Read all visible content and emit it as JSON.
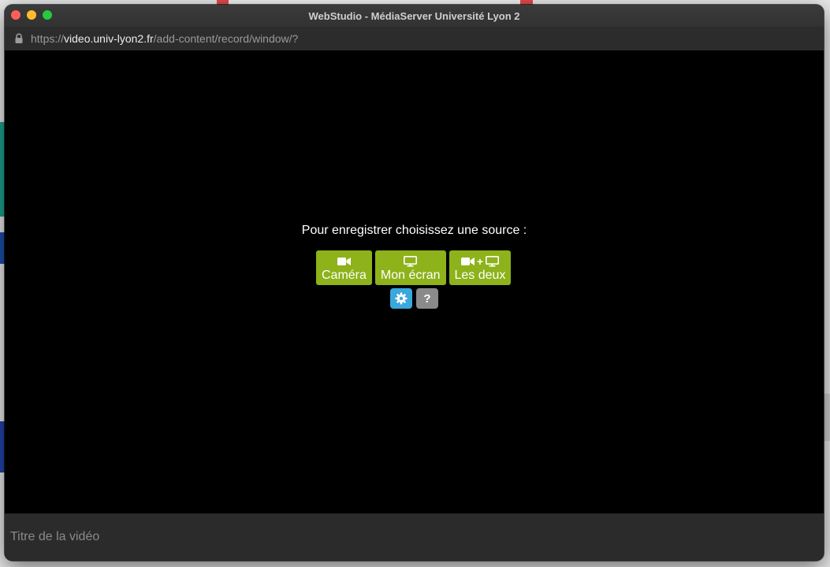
{
  "window": {
    "title": "WebStudio - MédiaServer Université Lyon 2"
  },
  "address_bar": {
    "scheme": "https://",
    "host": "video.univ-lyon2.fr",
    "path": "/add-content/record/window/?"
  },
  "recorder": {
    "prompt": "Pour enregistrer choisissez une source :",
    "sources": [
      {
        "label": "Caméra",
        "icon": "video-camera-icon"
      },
      {
        "label": "Mon écran",
        "icon": "monitor-icon"
      },
      {
        "label": "Les deux",
        "icon": "camera-plus-monitor-icon"
      }
    ],
    "plus_sign": "+",
    "help_label": "?"
  },
  "footer": {
    "title_placeholder": "Titre de la vidéo"
  },
  "colors": {
    "source_button": "#8db21a",
    "settings_button": "#3aa7dd",
    "help_button": "#8a8a8a",
    "stage_background": "#000000"
  }
}
